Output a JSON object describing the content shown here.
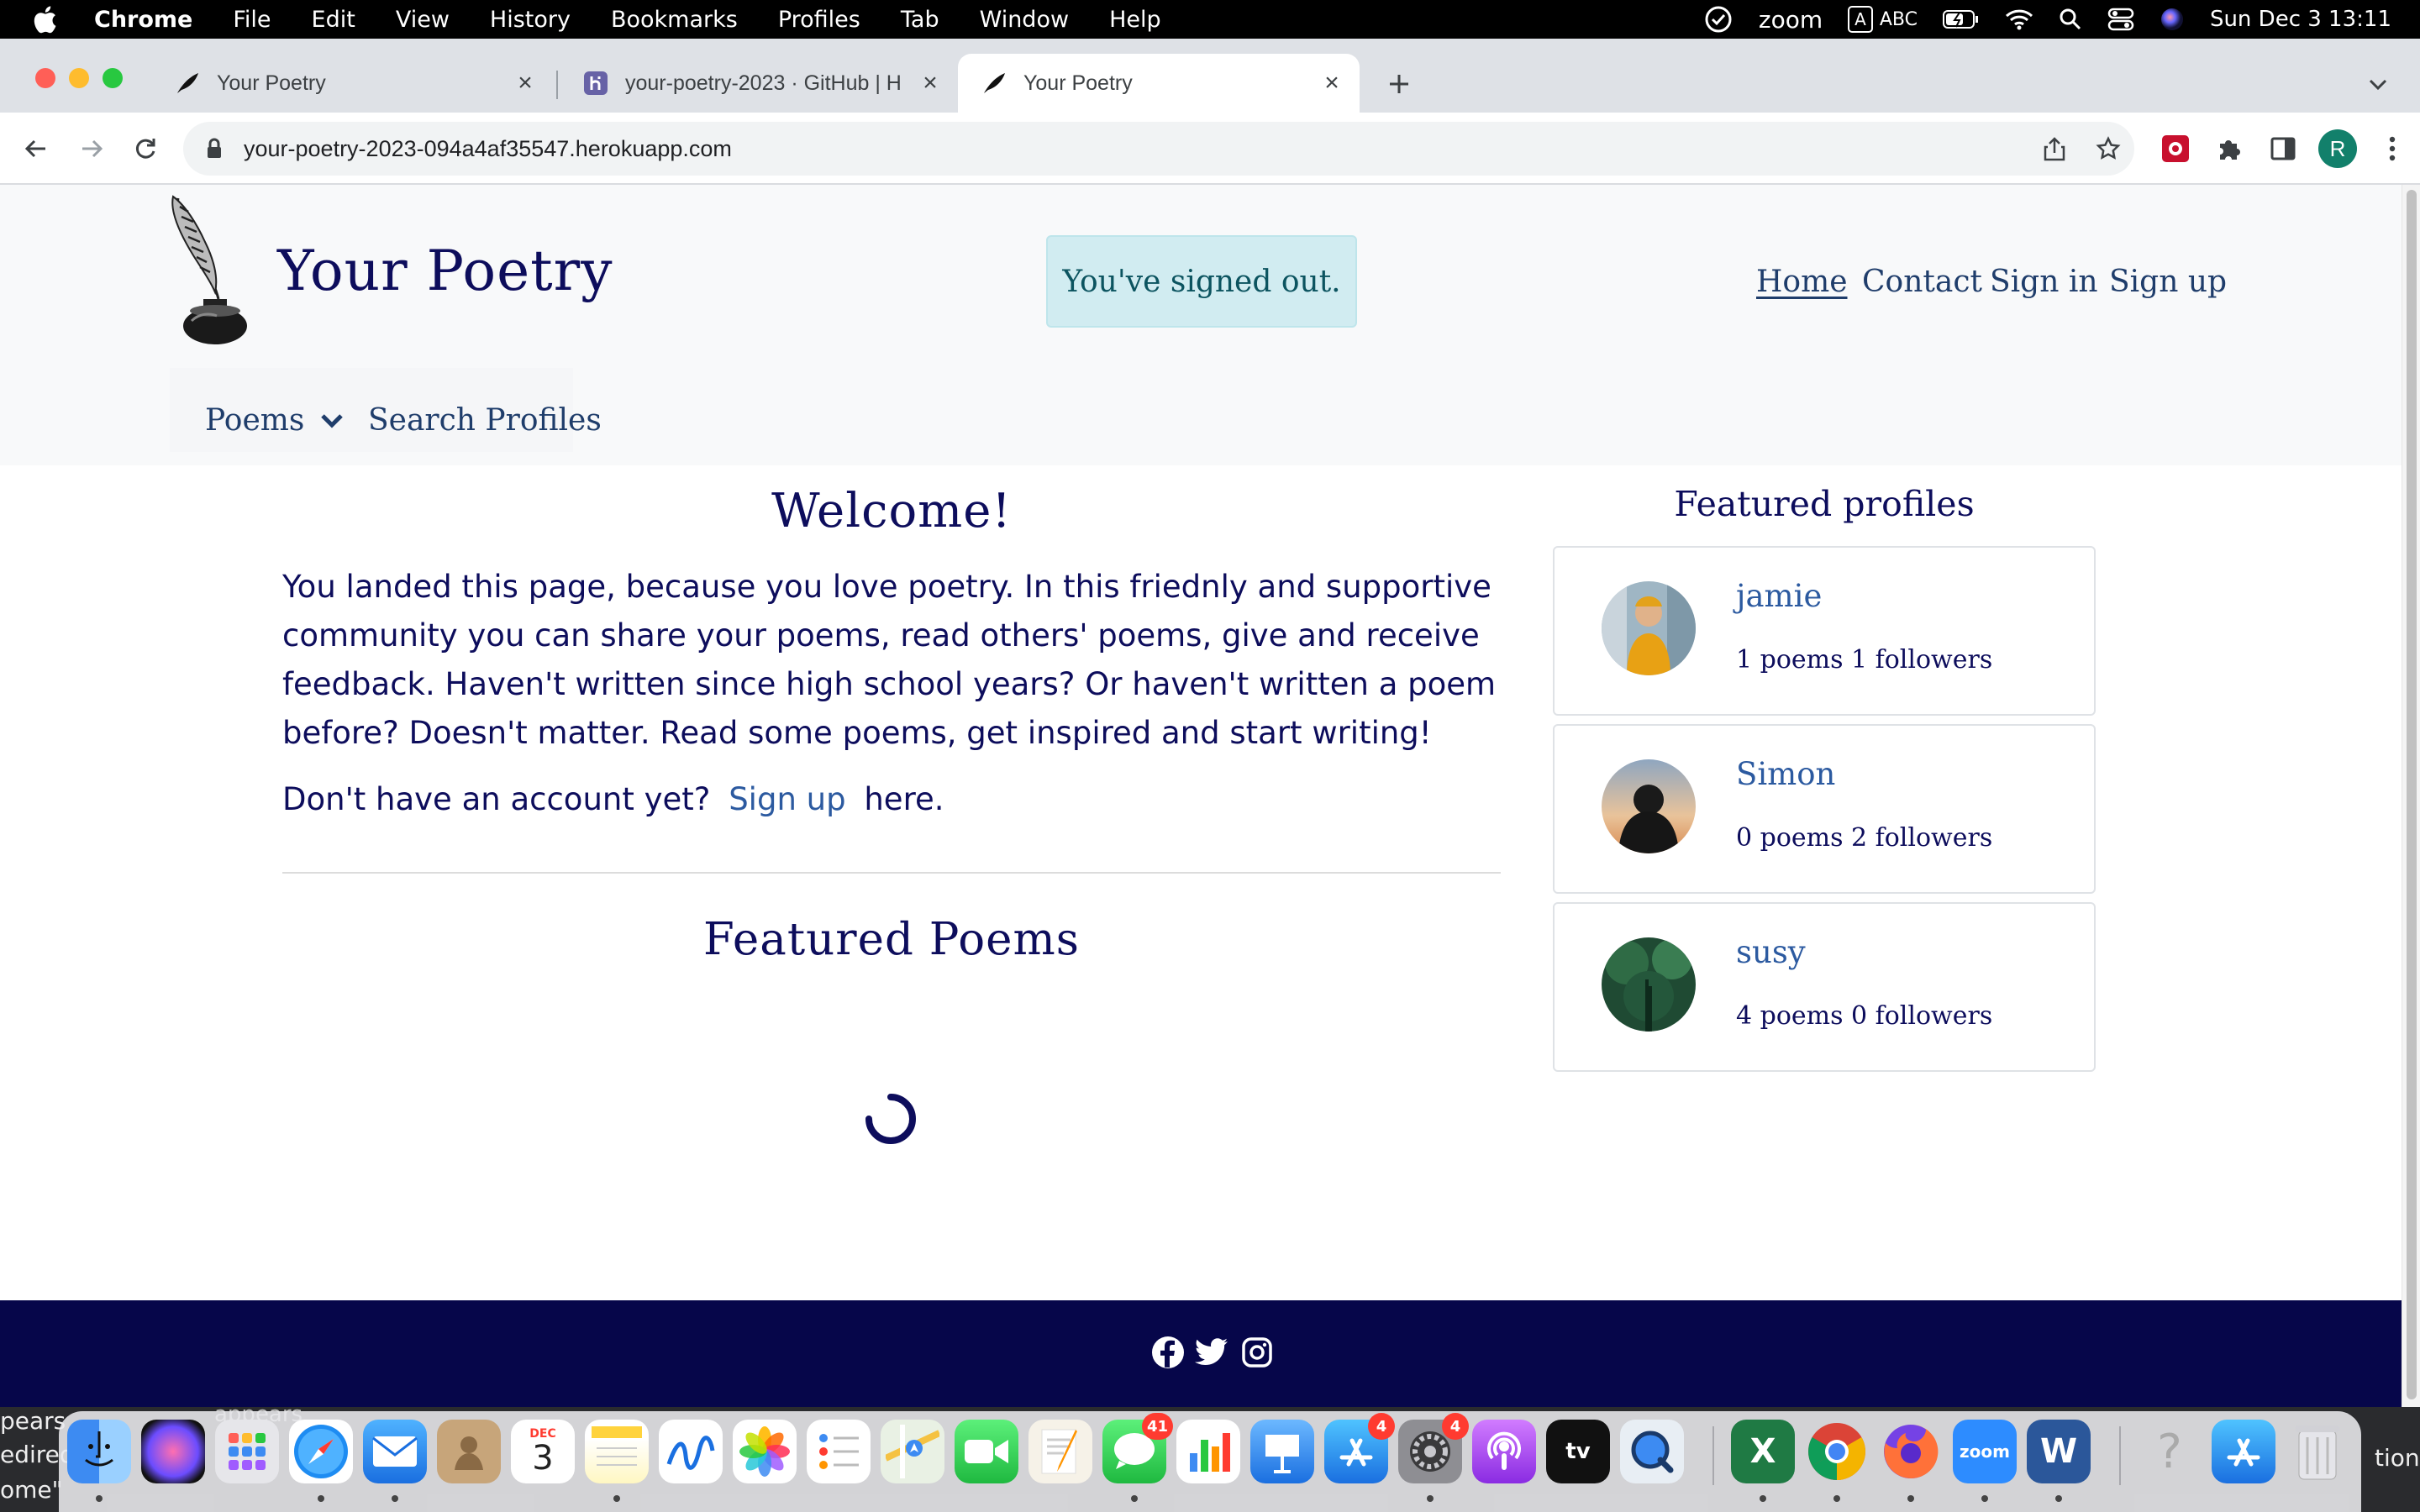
{
  "menubar": {
    "items": [
      "Chrome",
      "File",
      "Edit",
      "View",
      "History",
      "Bookmarks",
      "Profiles",
      "Tab",
      "Window",
      "Help"
    ],
    "zoom_label": "zoom",
    "input_box": "A",
    "input_label": "ABC",
    "datetime": "Sun Dec 3  13:11"
  },
  "browser": {
    "tabs": [
      {
        "title": "Your Poetry"
      },
      {
        "title": "your-poetry-2023 · GitHub | H"
      },
      {
        "title": "Your Poetry"
      }
    ],
    "url": "your-poetry-2023-094a4af35547.herokuapp.com",
    "profile_initial": "R"
  },
  "site": {
    "brand": "Your Poetry",
    "alert": "You've signed out.",
    "nav": [
      "Home",
      "Contact",
      "Sign in",
      "Sign up"
    ],
    "subnav": {
      "poems": "Poems",
      "search": "Search Profiles"
    }
  },
  "main": {
    "welcome_title": "Welcome!",
    "intro": "You landed this page, because you love poetry. In this friednly and supportive community you can share your poems, read others' poems, give and receive feedback. Haven't written since high school years? Or haven't written a poem before? Doesn't matter. Read some poems, get inspired and start writing!",
    "signup_prefix": "Don't have an account yet?",
    "signup_link": "Sign up",
    "signup_suffix": "here.",
    "featured_poems_title": "Featured Poems"
  },
  "profiles": {
    "title": "Featured profiles",
    "items": [
      {
        "name": "jamie",
        "stats": "1 poems  1 followers"
      },
      {
        "name": "Simon",
        "stats": "0 poems  2 followers"
      },
      {
        "name": "susy",
        "stats": "4 poems  0 followers"
      }
    ]
  },
  "dock": {
    "calendar_month": "DEC",
    "calendar_day": "3",
    "messages_badge": "41",
    "appstore_badge": "4",
    "settings_badge": "4",
    "tv_label": "tv",
    "excel_label": "X",
    "zoom_label": "zoom",
    "word_label": "W",
    "help_label": "?"
  },
  "background_fragments": {
    "left_1": "pears",
    "left_2": "edired",
    "left_3": "ome\"",
    "behind_dock": "appears",
    "right": "tions"
  },
  "colors": {
    "site_navy": "#0d0d5c",
    "link_blue": "#2c5aa0",
    "alert_bg": "#d1ecf1",
    "footer_bg": "#06064a"
  }
}
